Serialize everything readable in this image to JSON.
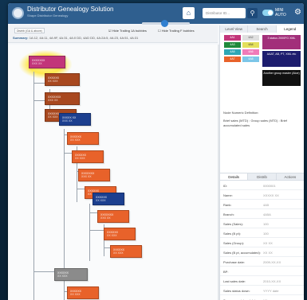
{
  "header": {
    "title": "Distributor Genealogy Solution",
    "subtitle": "Shape Distributor Genealogy",
    "search_placeholder": "Distributor ID...",
    "toggle_label": "MINI\nAUTO"
  },
  "toolbar": {
    "select_value": "Distrib (GA & above)",
    "check1": "Hide Trailing 1A bubbles",
    "check2": "Hide Trailing F bubbles",
    "summary_label": "Summary:",
    "summary_text": "1A:12, 4A:11, 4A:9F, 4A:31, 4A:0 DD, 4AD DD, 4A:2A:5, 4A:23, 4A:51, 4A:31"
  },
  "right_tabs": [
    "Level View",
    "Search",
    "Legend"
  ],
  "legend": {
    "items": [
      "4A1",
      "4A2",
      "4A3",
      "4A4",
      "4A5",
      "4A6",
      "4A7",
      "4A8"
    ],
    "box1": "3 status 2000FG XML",
    "box2": "AAAT, AB, PT, XML etc",
    "box3": "Another group master (Aloe)"
  },
  "node_definition": {
    "title": "Node Numeric Definition:",
    "text": "Brief sales (MTD) : Group sales (MTD) : Brief accumulated sales"
  },
  "detail_tabs": [
    "Details",
    "Distrib",
    "Actions"
  ],
  "details": [
    {
      "k": "ID:",
      "v": "0000001"
    },
    {
      "k": "Name:",
      "v": "XXXXX XX"
    },
    {
      "k": "Rank:",
      "v": "4A5"
    },
    {
      "k": "Branch:",
      "v": "4A5A"
    },
    {
      "k": "Sales (Sales):",
      "v": "100"
    },
    {
      "k": "Sales (B pt):",
      "v": "100"
    },
    {
      "k": "Sales (Group):",
      "v": "XX XX"
    },
    {
      "k": "Sales (B pt, accumulated):",
      "v": "XX XX"
    },
    {
      "k": "Purchase date:",
      "v": "2009-XX-XX"
    },
    {
      "k": "BP:",
      "v": ""
    },
    {
      "k": "Last sales date:",
      "v": "2010-XX-XX"
    },
    {
      "k": "Sales status down:",
      "v": "YYYY date"
    },
    {
      "k": "Sponsor registered date:",
      "v": "XX"
    }
  ],
  "tree": [
    {
      "nm": "XXXXXXX",
      "id": "XXX XX"
    },
    {
      "nm": "XXXXXX",
      "id": "XX XXX"
    },
    {
      "nm": "XXXXXXX",
      "id": "XXX XX"
    },
    {
      "nm": "XXXXXX",
      "id": "XX XXX"
    },
    {
      "nm": "XXXXX XX",
      "id": "XXX XX"
    },
    {
      "nm": "XXXXXX",
      "id": "XX XXX"
    },
    {
      "nm": "XXXXXX",
      "id": "XX XXX"
    },
    {
      "nm": "XXXXXXX",
      "id": "XXX XX"
    },
    {
      "nm": "XXXXXX",
      "id": "XX XXX"
    },
    {
      "nm": "XXXXXX",
      "id": "XX XXX"
    },
    {
      "nm": "XXXXXXX",
      "id": "XXX XX"
    },
    {
      "nm": "XXXXXX",
      "id": "XX XXX"
    },
    {
      "nm": "XXXXXX",
      "id": "XX XXX"
    },
    {
      "nm": "XXXXXX",
      "id": "XX XXX"
    },
    {
      "nm": "XXXXXX",
      "id": "XX XXX"
    }
  ],
  "colors": {
    "header": "#2f5f8f",
    "magenta": "#c2357a",
    "brown": "#a8481f",
    "navy": "#1c3f8f",
    "orange": "#e8622a",
    "gray": "#8b8b8b"
  }
}
